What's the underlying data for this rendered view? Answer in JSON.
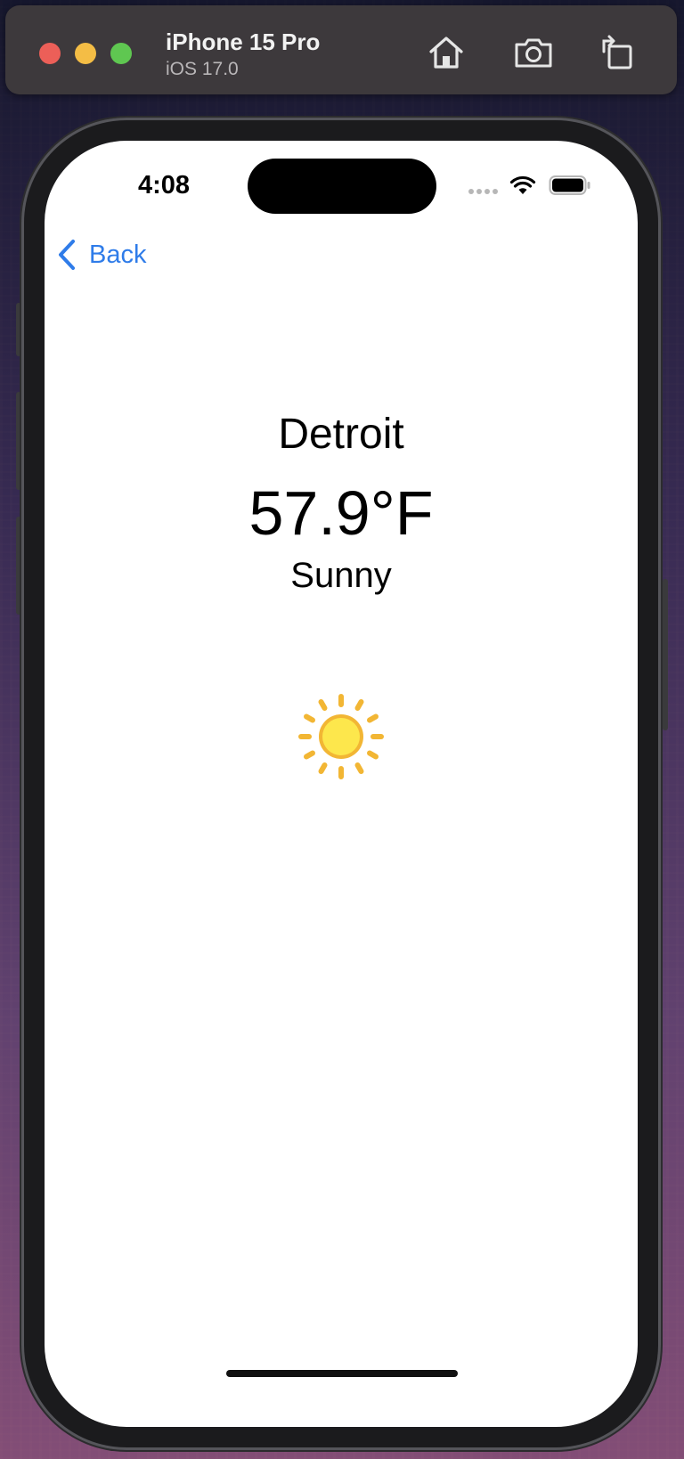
{
  "simulator": {
    "device_name": "iPhone 15 Pro",
    "os_version": "iOS 17.0",
    "buttons": {
      "home_icon": "home-icon",
      "screenshot_icon": "camera-icon",
      "rotate_icon": "rotate-icon"
    }
  },
  "status_bar": {
    "time": "4:08"
  },
  "navigation": {
    "back_label": "Back"
  },
  "weather": {
    "city": "Detroit",
    "temperature": "57.9°F",
    "condition": "Sunny",
    "condition_icon": "sun-icon"
  },
  "colors": {
    "accent": "#2f7ce9",
    "sun_core": "#fde74c",
    "sun_rays": "#f2b634"
  }
}
